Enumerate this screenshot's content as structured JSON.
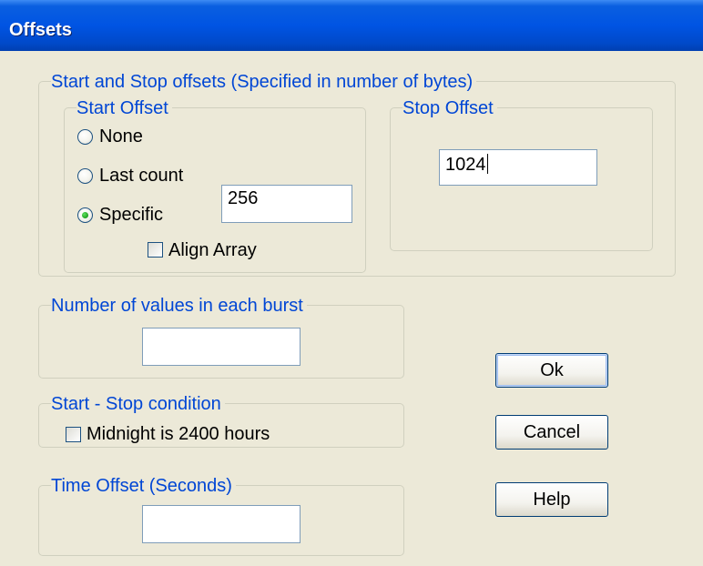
{
  "window": {
    "title": "Offsets"
  },
  "offsets_group": {
    "legend": "Start and Stop offsets (Specified in number of bytes)",
    "start": {
      "legend": "Start Offset",
      "options": {
        "none": "None",
        "last_count": "Last count",
        "specific": "Specific"
      },
      "selected": "Specific",
      "specific_value": "256",
      "align_array_label": "Align Array",
      "align_array_checked": false
    },
    "stop": {
      "legend": "Stop Offset",
      "value": "1024"
    }
  },
  "burst_group": {
    "legend": "Number of values in each burst",
    "value": ""
  },
  "condition_group": {
    "legend": "Start - Stop condition",
    "midnight_label": "Midnight is 2400 hours",
    "midnight_checked": false
  },
  "time_group": {
    "legend": "Time Offset (Seconds)",
    "value": ""
  },
  "buttons": {
    "ok": "Ok",
    "cancel": "Cancel",
    "help": "Help"
  }
}
